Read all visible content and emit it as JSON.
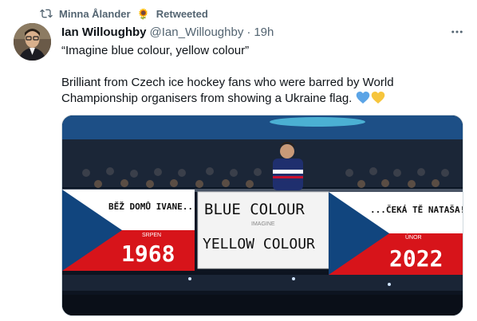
{
  "retweet": {
    "name": "Minna Ålander",
    "emoji": "🌻",
    "label": "Retweeted"
  },
  "tweet": {
    "author_name": "Ian Willoughby",
    "handle": "@Ian_Willoughby",
    "separator": "·",
    "time": "19h",
    "line1": "“Imagine blue colour, yellow colour”",
    "line2": "Brilliant from Czech ice hockey fans who were barred by World Championship organisers from showing a Ukraine flag."
  },
  "image": {
    "banner_left": "BĚŽ DOMŮ IVANE...",
    "left_month": "SRPEN",
    "left_year": "1968",
    "center_top": "BLUE COLOUR",
    "center_mid": "IMAGINE",
    "center_bottom": "YELLOW COLOUR",
    "banner_right": "...ČEKÁ TĚ NATAŠA!",
    "right_month": "ÚNOR",
    "right_year": "2022"
  },
  "icons": {
    "retweet": "retweet-icon",
    "more": "more-icon",
    "heart_blue": "#5ba4e6",
    "heart_yellow": "#f6c53c"
  }
}
